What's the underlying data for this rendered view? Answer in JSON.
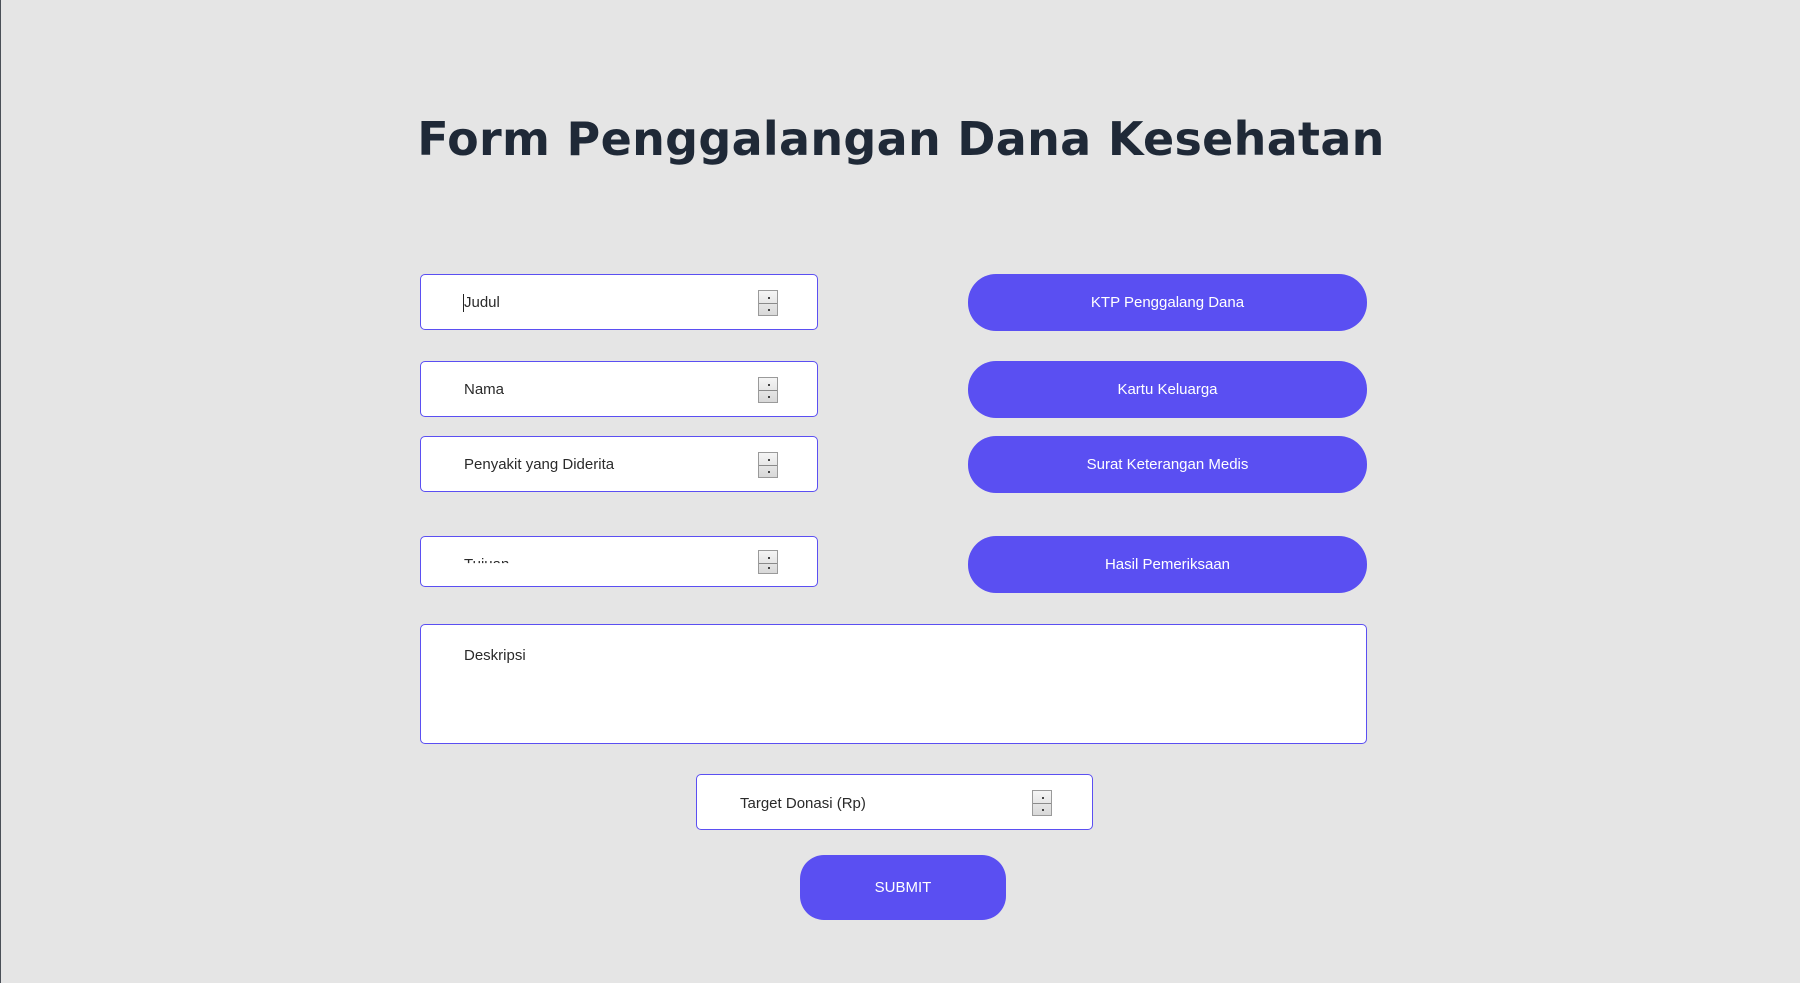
{
  "page": {
    "title": "Form Penggalangan Dana Kesehatan"
  },
  "form": {
    "fields": {
      "judul": "Judul",
      "nama": "Nama",
      "penyakit": "Penyakit yang Diderita",
      "tujuan": "Tujuan",
      "deskripsi": "Deskripsi",
      "target": "Target Donasi (Rp)"
    },
    "uploads": {
      "ktp": "KTP Penggalang Dana",
      "kk": "Kartu Keluarga",
      "surat_medis": "Surat Keterangan Medis",
      "hasil": "Hasil Pemeriksaan"
    },
    "submit_label": "SUBMIT"
  },
  "colors": {
    "background": "#e5e5e5",
    "accent": "#5a4ff2",
    "title": "#1f2937"
  },
  "icons": {
    "spinner": "number-spinner-icon"
  }
}
